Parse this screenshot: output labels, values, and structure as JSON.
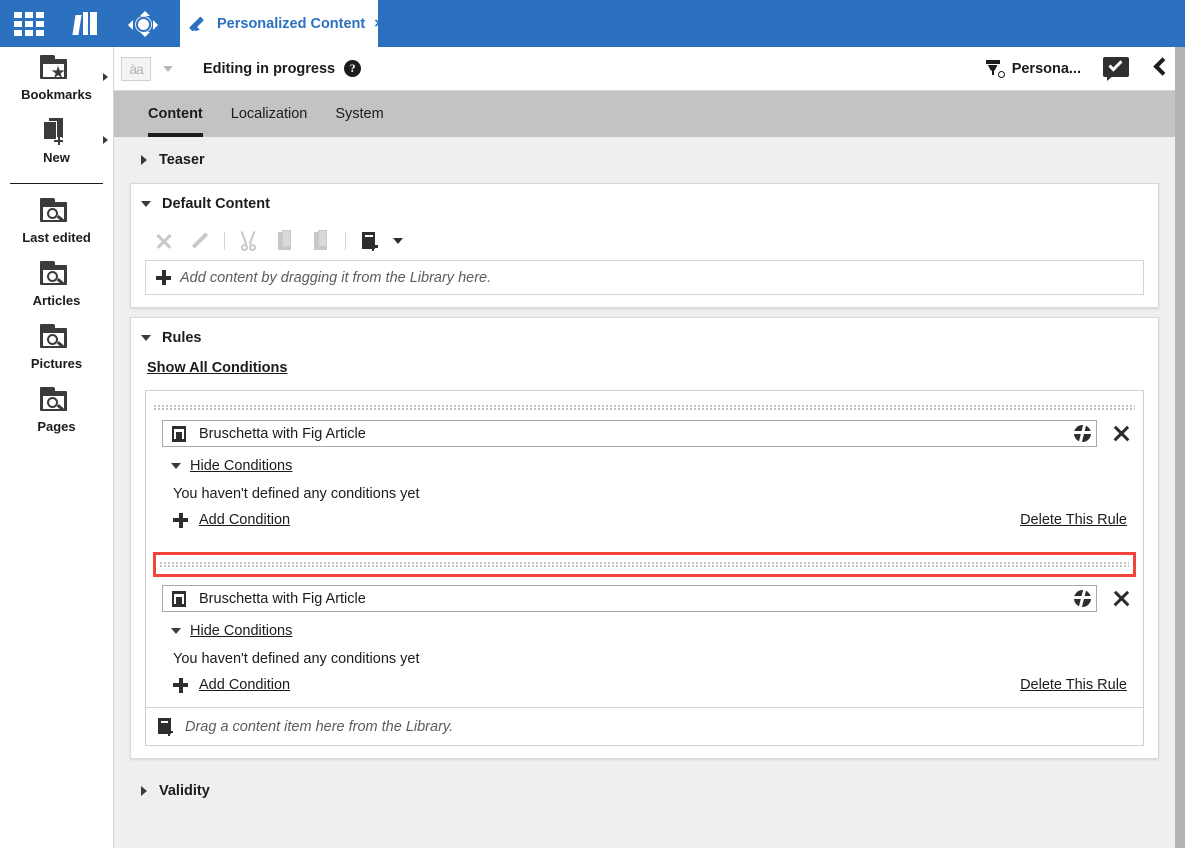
{
  "topbar": {
    "apps_icon": "grid-apps-icon",
    "library_icon": "library-books-icon",
    "move_icon": "move-crosshair-icon",
    "tab": {
      "label": "Personalized Content",
      "close": "×",
      "pencil_icon": "pencil-icon"
    },
    "accent_color": "#2b71bf"
  },
  "subbar": {
    "locale_icon_text": "àa",
    "status_text": "Editing in progress",
    "help_label": "?",
    "persona_label": "Persona...",
    "persona_icon": "persona-funnel-icon",
    "approve_icon": "approve-checkmark-icon",
    "collapse_icon": "chevron-left-icon"
  },
  "sidebar": {
    "items": [
      {
        "label": "Bookmarks",
        "icon": "folder-star-icon",
        "has_arrow": true
      },
      {
        "label": "New",
        "icon": "new-document-icon",
        "has_arrow": true
      },
      {
        "label": "Last edited",
        "icon": "folder-search-icon",
        "has_arrow": false
      },
      {
        "label": "Articles",
        "icon": "folder-search-icon",
        "has_arrow": false
      },
      {
        "label": "Pictures",
        "icon": "folder-search-icon",
        "has_arrow": false
      },
      {
        "label": "Pages",
        "icon": "folder-search-icon",
        "has_arrow": false
      }
    ]
  },
  "form_tabs": [
    {
      "label": "Content",
      "active": true
    },
    {
      "label": "Localization",
      "active": false
    },
    {
      "label": "System",
      "active": false
    }
  ],
  "sections": {
    "teaser": {
      "title": "Teaser",
      "expanded": false
    },
    "default_content": {
      "title": "Default Content",
      "expanded": true,
      "toolbar": [
        {
          "name": "remove-icon",
          "disabled": true
        },
        {
          "name": "edit-pencil-icon",
          "disabled": true
        },
        {
          "name": "cut-scissors-icon",
          "disabled": true
        },
        {
          "name": "copy-icon",
          "disabled": true
        },
        {
          "name": "paste-icon",
          "disabled": true
        },
        {
          "name": "add-content-icon",
          "disabled": false
        }
      ],
      "dropzone_hint": "Add content by dragging it from the Library here."
    },
    "rules": {
      "title": "Rules",
      "expanded": true,
      "show_all_conditions": "Show All Conditions",
      "items": [
        {
          "content_name": "Bruschetta with Fig Article",
          "content_icon": "article-icon",
          "picker_icon": "sphere-picker-icon",
          "delete_icon": "delete-x-icon",
          "toggle_conditions_label": "Hide Conditions",
          "no_conditions_text": "You haven't defined any conditions yet",
          "add_condition_label": "Add Condition",
          "delete_rule_label": "Delete This Rule",
          "drop_highlight": false
        },
        {
          "content_name": "Bruschetta with Fig Article",
          "content_icon": "article-icon",
          "picker_icon": "sphere-picker-icon",
          "delete_icon": "delete-x-icon",
          "toggle_conditions_label": "Hide Conditions",
          "no_conditions_text": "You haven't defined any conditions yet",
          "add_condition_label": "Add Condition",
          "delete_rule_label": "Delete This Rule",
          "drop_highlight": true
        }
      ],
      "drag_footer_text": "Drag a content item here from the Library.",
      "drag_footer_icon": "drag-content-icon",
      "highlight_color": "#f4423c"
    },
    "validity": {
      "title": "Validity",
      "expanded": false
    }
  }
}
